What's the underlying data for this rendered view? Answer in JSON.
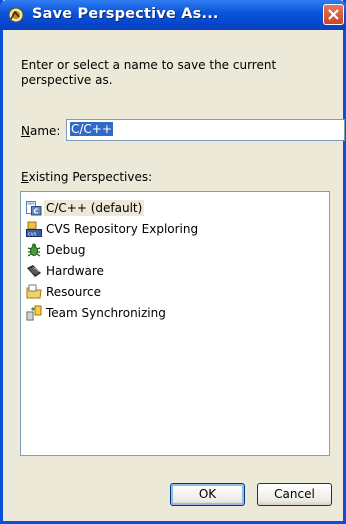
{
  "window": {
    "title": "Save Perspective As..."
  },
  "dialog": {
    "description": "Enter or select a name to save the current perspective as.",
    "name_label_accel": "N",
    "name_label_rest": "ame:",
    "name_value": "C/C++",
    "existing_label_accel": "E",
    "existing_label_rest": "xisting Perspectives:"
  },
  "perspectives": [
    {
      "label": "C/C++ (default)",
      "icon": "cpp-perspective-icon",
      "selected": true
    },
    {
      "label": "CVS Repository Exploring",
      "icon": "cvs-repository-icon",
      "selected": false
    },
    {
      "label": "Debug",
      "icon": "debug-bug-icon",
      "selected": false
    },
    {
      "label": "Hardware",
      "icon": "hardware-icon",
      "selected": false
    },
    {
      "label": "Resource",
      "icon": "resource-folder-icon",
      "selected": false
    },
    {
      "label": "Team Synchronizing",
      "icon": "team-sync-icon",
      "selected": false
    }
  ],
  "buttons": {
    "ok": "OK",
    "cancel": "Cancel"
  }
}
